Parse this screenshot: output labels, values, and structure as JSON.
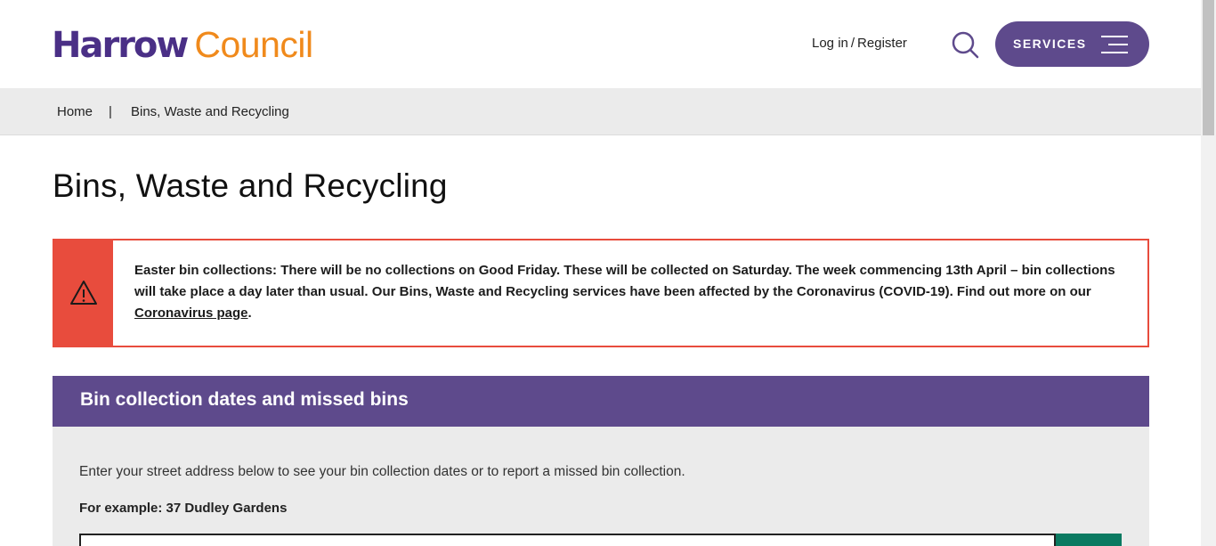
{
  "header": {
    "logo_primary": "Harrow",
    "logo_secondary": "Council",
    "login_label": "Log in",
    "login_separator": "/",
    "register_label": "Register",
    "services_label": "SERVICES",
    "search_icon": "search-icon",
    "menu_icon": "hamburger-icon"
  },
  "breadcrumb": {
    "home": "Home",
    "separator": "|",
    "current": "Bins, Waste and Recycling"
  },
  "page": {
    "title": "Bins, Waste and Recycling"
  },
  "alert": {
    "icon": "warning-icon",
    "text_before_link": "Easter bin collections: There will be no collections on Good Friday. These will be collected on Saturday. The week commencing 13th April – bin collections will take place a day later than usual. Our Bins, Waste and Recycling services have been affected by the Coronavirus (COVID-19). Find out more on our ",
    "link_text": "Coronavirus page",
    "text_after_link": ".",
    "color": "#e84c3d"
  },
  "bin_panel": {
    "title": "Bin collection dates and missed bins",
    "intro": "Enter your street address below to see your bin collection dates or to report a missed bin collection.",
    "example": "For example: 37 Dudley Gardens",
    "input_value": ""
  },
  "colors": {
    "brand_purple": "#4a2f86",
    "brand_orange": "#f08a1c",
    "button_purple": "#5e4a8c",
    "alert_red": "#e84c3d",
    "submit_green": "#0b7a61"
  }
}
